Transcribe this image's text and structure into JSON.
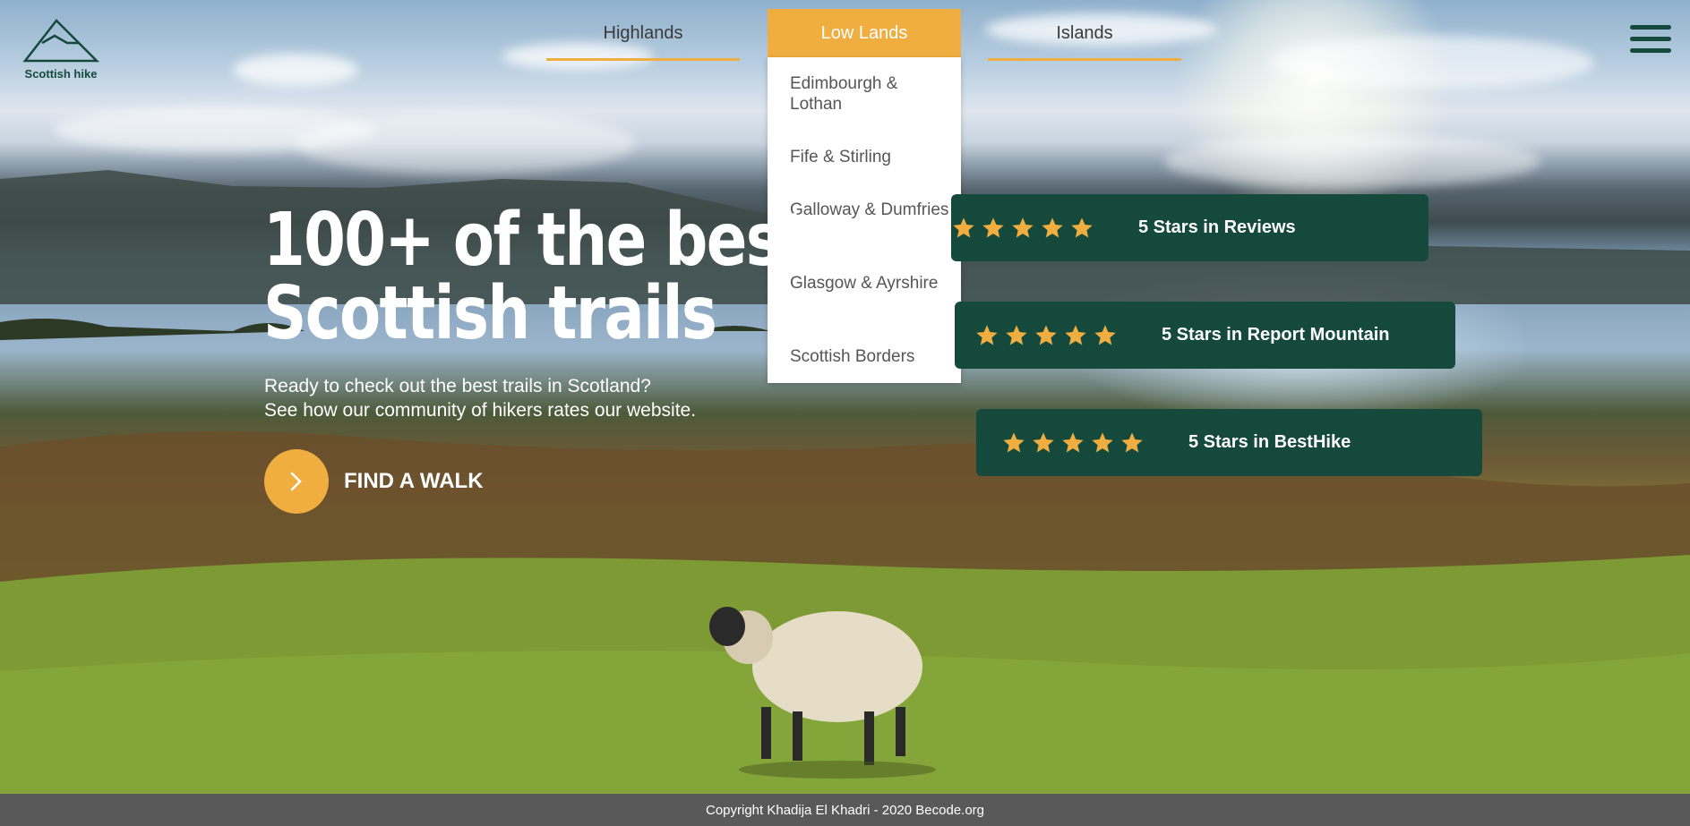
{
  "brand": {
    "name": "Scottish hike"
  },
  "nav": {
    "items": [
      {
        "label": "Highlands"
      },
      {
        "label": "Low Lands"
      },
      {
        "label": "Islands"
      }
    ],
    "active": "Low Lands",
    "dropdown": [
      {
        "label": "Edimbourgh & Lothan"
      },
      {
        "label": "Fife & Stirling"
      },
      {
        "label": "Galloway & Dumfries"
      },
      {
        "label": "Glasgow & Ayrshire"
      },
      {
        "label": "Scottish Borders"
      }
    ]
  },
  "hero": {
    "headline_line1": "100+ of the best",
    "headline_line2": "Scottish trails",
    "sub_line1": "Ready to check out the best trails in Scotland?",
    "sub_line2": "See how our community of hikers rates our website.",
    "cta_label": "FIND A WALK"
  },
  "reviews": [
    {
      "label": "5 Stars in Reviews",
      "stars": 5
    },
    {
      "label": "5 Stars in Report Mountain",
      "stars": 5
    },
    {
      "label": "5 Stars in BestHike",
      "stars": 5
    }
  ],
  "footer": {
    "text": "Copyright Khadija El Khadri - 2020 Becode.org"
  },
  "colors": {
    "accent": "#f0ae41",
    "brand_green": "#14493c",
    "footer_bg": "#595959"
  },
  "icons": [
    "mountain-logo-icon",
    "hamburger-menu-icon",
    "chevron-right-icon",
    "star-icon"
  ]
}
